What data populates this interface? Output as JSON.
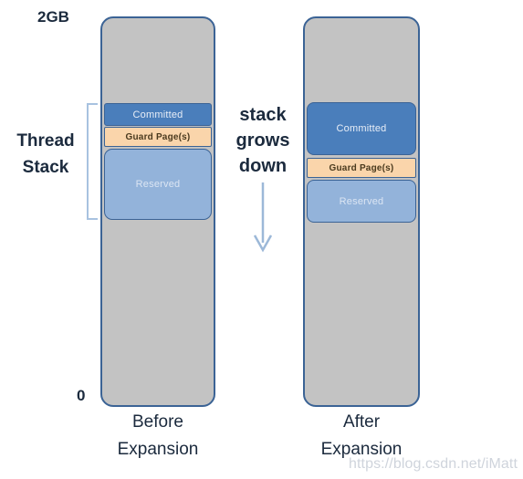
{
  "diagram": {
    "scale": {
      "top_label": "2GB",
      "bottom_label": "0"
    },
    "thread_stack_label": {
      "line1": "Thread",
      "line2": "Stack"
    },
    "center_annotation": {
      "line1": "stack",
      "line2": "grows",
      "line3": "down",
      "arrow_icon": "arrow-down-icon"
    },
    "columns": [
      {
        "id": "before",
        "caption_line1": "Before",
        "caption_line2": "Expansion",
        "bands": [
          {
            "label": "Committed",
            "color": "#4a7ebb"
          },
          {
            "label": "Guard Page(s)",
            "color": "#fad5ab"
          },
          {
            "label": "Reserved",
            "color": "#93b3da"
          }
        ]
      },
      {
        "id": "after",
        "caption_line1": "After",
        "caption_line2": "Expansion",
        "bands": [
          {
            "label": "Committed",
            "color": "#4a7ebb"
          },
          {
            "label": "Guard Page(s)",
            "color": "#fad5ab"
          },
          {
            "label": "Reserved",
            "color": "#93b3da"
          }
        ]
      }
    ],
    "colors": {
      "unused_memory": "#c3c3c3",
      "outline": "#3b6395",
      "bracket": "#a8c2e0",
      "arrow": "#9cb8d8",
      "text": "#1b2a3d"
    },
    "watermark": "https://blog.csdn.net/iMatt"
  }
}
